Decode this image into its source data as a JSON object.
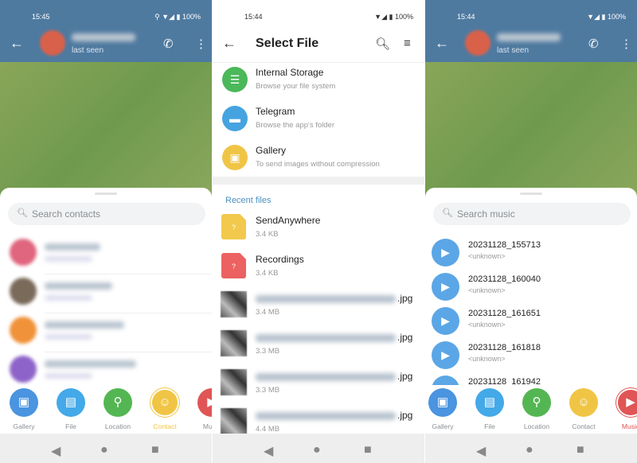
{
  "left": {
    "time": "15:45",
    "battery": "100%",
    "last_seen": "last seen",
    "search_placeholder": "Search contacts",
    "contacts": [
      {
        "color": "#e0657e"
      },
      {
        "color": "#7a6a5a"
      },
      {
        "color": "#f0923a"
      },
      {
        "color": "#8e63c9"
      }
    ],
    "attach": [
      {
        "label": "Gallery",
        "color": "#4a94e0",
        "icon": "image-icon"
      },
      {
        "label": "File",
        "color": "#43a9e8",
        "icon": "file-icon"
      },
      {
        "label": "Location",
        "color": "#54b653",
        "icon": "location-icon"
      },
      {
        "label": "Contact",
        "color": "#f0c545",
        "icon": "contact-icon",
        "active": true
      },
      {
        "label": "Music",
        "color": "#e05555",
        "icon": "music-icon"
      }
    ]
  },
  "middle": {
    "time": "15:44",
    "battery": "100%",
    "title": "Select File",
    "sources": [
      {
        "title": "Internal Storage",
        "sub": "Browse your file system",
        "color": "#4bb85a",
        "icon": "storage-icon"
      },
      {
        "title": "Telegram",
        "sub": "Browse the app's folder",
        "color": "#45a3e0",
        "icon": "folder-icon"
      },
      {
        "title": "Gallery",
        "sub": "To send images without compression",
        "color": "#f0c545",
        "icon": "image-icon"
      }
    ],
    "recent_label": "Recent files",
    "files": [
      {
        "name": "SendAnywhere",
        "size": "3.4 KB",
        "type": "yellow"
      },
      {
        "name": "Recordings",
        "size": "3.4 KB",
        "type": "red"
      },
      {
        "name": ".jpg",
        "size": "3.4 MB",
        "type": "img"
      },
      {
        "name": ".jpg",
        "size": "3.3 MB",
        "type": "img"
      },
      {
        "name": ".jpg",
        "size": "3.3 MB",
        "type": "img"
      },
      {
        "name": ".jpg",
        "size": "4.4 MB",
        "type": "img"
      }
    ]
  },
  "right": {
    "time": "15:44",
    "battery": "100%",
    "last_seen": "last seen",
    "search_placeholder": "Search music",
    "tracks": [
      {
        "title": "20231128_155713",
        "artist": "<unknown>"
      },
      {
        "title": "20231128_160040",
        "artist": "<unknown>"
      },
      {
        "title": "20231128_161651",
        "artist": "<unknown>"
      },
      {
        "title": "20231128_161818",
        "artist": "<unknown>"
      },
      {
        "title": "20231128_161942",
        "artist": ""
      }
    ],
    "attach": [
      {
        "label": "Gallery",
        "color": "#4a94e0"
      },
      {
        "label": "File",
        "color": "#43a9e8"
      },
      {
        "label": "Location",
        "color": "#54b653"
      },
      {
        "label": "Contact",
        "color": "#f0c545"
      },
      {
        "label": "Music",
        "color": "#e05555",
        "active": true
      }
    ]
  }
}
